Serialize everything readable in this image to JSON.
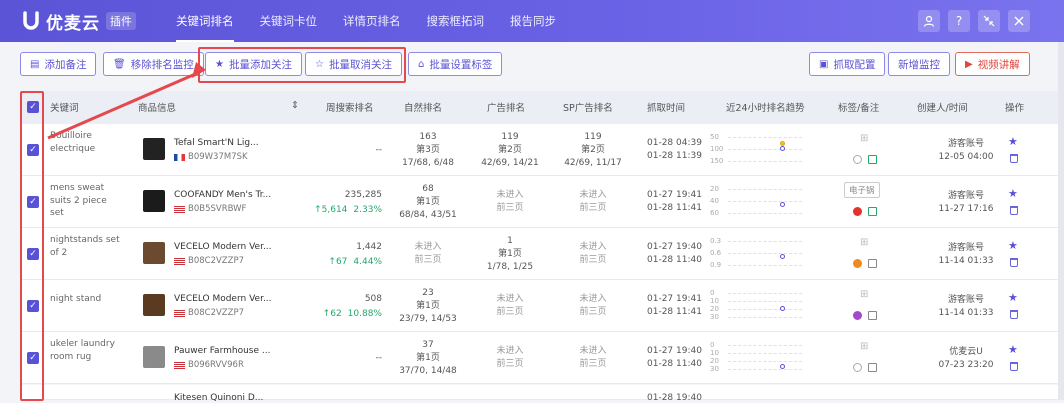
{
  "header": {
    "logo_text": "优麦云",
    "logo_tag": "插件",
    "nav": [
      "关键词排名",
      "关键词卡位",
      "详情页排名",
      "搜索框拓词",
      "报告同步"
    ],
    "icons": [
      "user-icon",
      "help-icon",
      "collapse-icon",
      "close-icon"
    ]
  },
  "toolbar": {
    "left": [
      "添加备注",
      "移除排名监控",
      "批量添加关注",
      "批量取消关注",
      "批量设置标签"
    ],
    "right": [
      "抓取配置",
      "新增监控",
      "视频讲解"
    ]
  },
  "columns": [
    "关键词",
    "商品信息",
    "周搜索排名",
    "自然排名",
    "广告排名",
    "SP广告排名",
    "抓取时间",
    "近24小时排名趋势",
    "标签/备注",
    "创建人/时间",
    "操作"
  ],
  "rows": [
    {
      "keyword": "Bouilloire electrique",
      "title": "Tefal Smart'N Lig...",
      "asin": "B09W37M7SK",
      "flag": "fr",
      "weekly": "--",
      "weekly_change": "",
      "weekly_pct": "",
      "natural": [
        "163",
        "第3页",
        "17/68, 6/48"
      ],
      "ad": [
        "119",
        "第2页",
        "42/69, 14/21"
      ],
      "sp": [
        "119",
        "第2页",
        "42/69, 11/17"
      ],
      "time": [
        "01-28 04:39",
        "01-28 11:39"
      ],
      "spark_labels": [
        "50",
        "100",
        "150"
      ],
      "tag": "",
      "creator": [
        "游客账号",
        "12-05 04:00"
      ],
      "circle_color": "#ffffff"
    },
    {
      "keyword": "mens sweat suits 2 piece set",
      "title": "COOFANDY Men's Tr...",
      "asin": "B0B5SVRBWF",
      "flag": "us",
      "weekly": "235,285",
      "weekly_change": "↑5,614",
      "weekly_pct": "2.33%",
      "natural": [
        "68",
        "第1页",
        "68/84, 43/51"
      ],
      "ad": [
        "未进入",
        "前三页",
        ""
      ],
      "sp": [
        "未进入",
        "前三页",
        ""
      ],
      "time": [
        "01-27 19:41",
        "01-28 11:41"
      ],
      "spark_labels": [
        "20",
        "40",
        "60"
      ],
      "tag": "电子锅",
      "creator": [
        "游客账号",
        "11-27 17:16"
      ],
      "circle_color": "#e5322d"
    },
    {
      "keyword": "nightstands set of 2",
      "title": "VECELO Modern Ver...",
      "asin": "B08C2VZZP7",
      "flag": "us",
      "weekly": "1,442",
      "weekly_change": "↑67",
      "weekly_pct": "4.44%",
      "natural": [
        "未进入",
        "前三页",
        ""
      ],
      "ad": [
        "1",
        "第1页",
        "1/78, 1/25"
      ],
      "sp": [
        "未进入",
        "前三页",
        ""
      ],
      "time": [
        "01-27 19:40",
        "01-28 11:40"
      ],
      "spark_labels": [
        "0.3",
        "0.6",
        "0.9"
      ],
      "tag": "",
      "creator": [
        "游客账号",
        "11-14 01:33"
      ],
      "circle_color": "#f08a1c"
    },
    {
      "keyword": "night stand",
      "title": "VECELO Modern Ver...",
      "asin": "B08C2VZZP7",
      "flag": "us",
      "weekly": "508",
      "weekly_change": "↑62",
      "weekly_pct": "10.88%",
      "natural": [
        "23",
        "第1页",
        "23/79, 14/53"
      ],
      "ad": [
        "未进入",
        "前三页",
        ""
      ],
      "sp": [
        "未进入",
        "前三页",
        ""
      ],
      "time": [
        "01-27 19:41",
        "01-28 11:41"
      ],
      "spark_labels": [
        "0",
        "10",
        "20",
        "30"
      ],
      "tag": "",
      "creator": [
        "游客账号",
        "11-14 01:33"
      ],
      "circle_color": "#a349c9"
    },
    {
      "keyword": "ukeler laundry room rug",
      "title": "Pauwer Farmhouse ...",
      "asin": "B096RVV96R",
      "flag": "us",
      "weekly": "--",
      "weekly_change": "",
      "weekly_pct": "",
      "natural": [
        "37",
        "第1页",
        "37/70, 14/48"
      ],
      "ad": [
        "未进入",
        "前三页",
        ""
      ],
      "sp": [
        "未进入",
        "前三页",
        ""
      ],
      "time": [
        "01-27 19:40",
        "01-28 11:40"
      ],
      "spark_labels": [
        "0",
        "10",
        "20",
        "30"
      ],
      "tag": "",
      "creator": [
        "优麦云U",
        "07-23 23:20"
      ],
      "circle_color": "#ffffff"
    }
  ],
  "partial_row": {
    "title": "Kitesen Quinoni D...",
    "time": "01-28 19:40"
  },
  "colors": {
    "accent": "#5a52d4",
    "highlight": "#e5484d",
    "up": "#24a86b"
  }
}
